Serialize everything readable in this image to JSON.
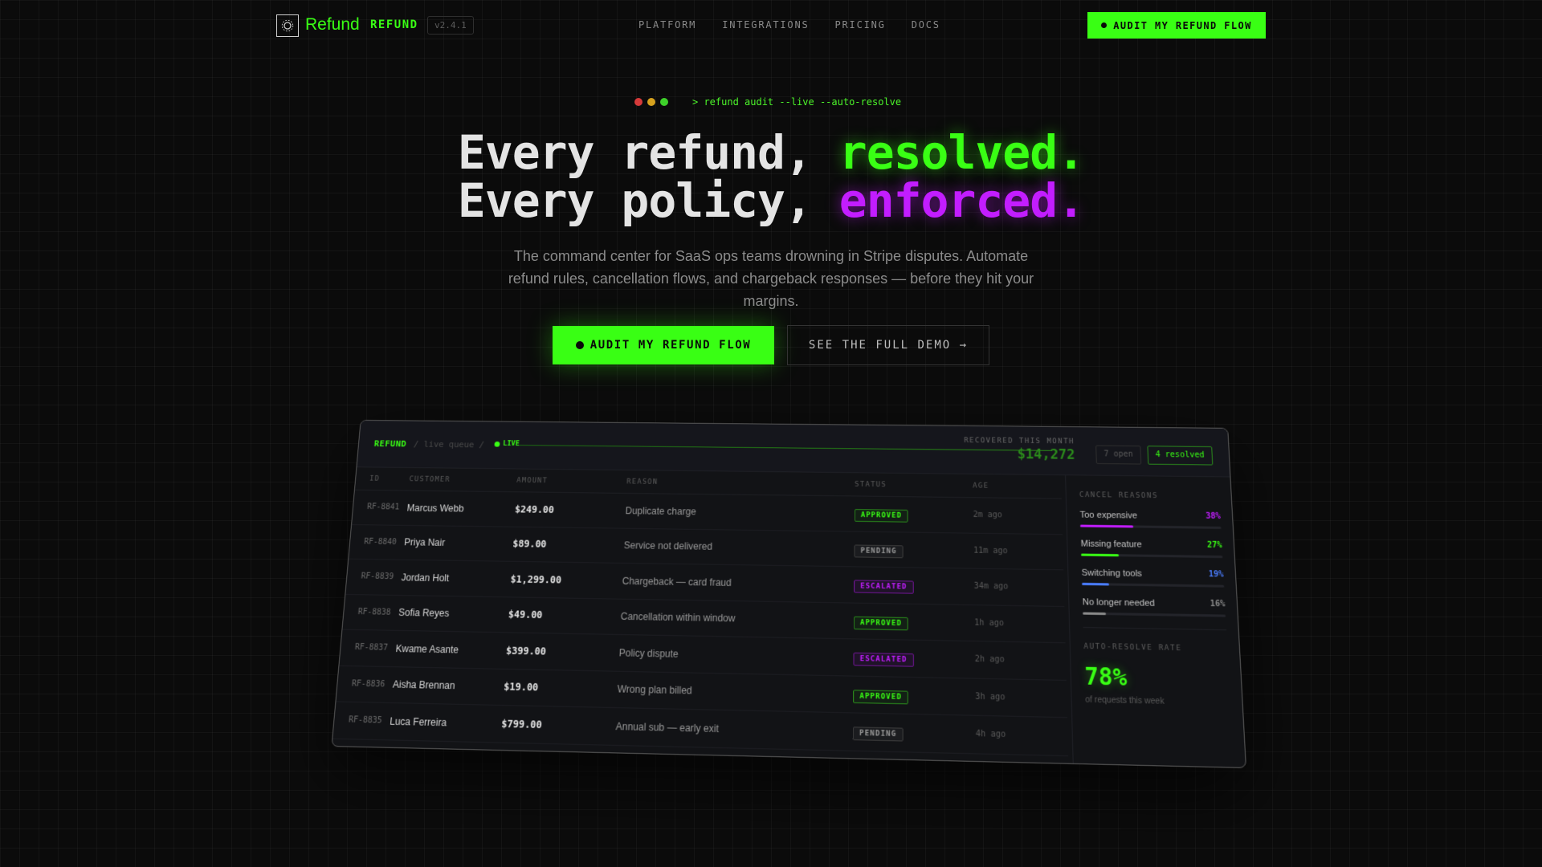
{
  "nav": {
    "brand": "Refund",
    "brand_tag": "REFUND",
    "version": "v2.4.1",
    "links": [
      "PLATFORM",
      "INTEGRATIONS",
      "PRICING",
      "DOCS"
    ],
    "cta": "AUDIT MY REFUND FLOW"
  },
  "hero": {
    "command": "> refund audit --live --auto-resolve",
    "line1_prefix": "Every refund, ",
    "line1_highlight": "resolved.",
    "line2_prefix": "Every policy, ",
    "line2_highlight": "enforced.",
    "subtitle": "The command center for SaaS ops teams drowning in Stripe disputes. Automate refund rules, cancellation flows, and chargeback responses — before they hit your margins.",
    "cta_primary": "AUDIT MY REFUND FLOW",
    "cta_secondary": "SEE THE FULL DEMO →"
  },
  "dashboard": {
    "brand": "REFUND",
    "path": "/ live queue /",
    "live_label": "LIVE",
    "recovered_label": "RECOVERED THIS MONTH",
    "recovered_value": "$14,272",
    "open_count": "7 open",
    "resolved_count": "4 resolved",
    "columns": [
      "ID",
      "CUSTOMER",
      "AMOUNT",
      "REASON",
      "STATUS",
      "AGE"
    ],
    "rows": [
      {
        "id": "RF-8841",
        "customer": "Marcus Webb",
        "amount": "$249.00",
        "reason": "Duplicate charge",
        "status": "APPROVED",
        "age": "2m ago"
      },
      {
        "id": "RF-8840",
        "customer": "Priya Nair",
        "amount": "$89.00",
        "reason": "Service not delivered",
        "status": "PENDING",
        "age": "11m ago"
      },
      {
        "id": "RF-8839",
        "customer": "Jordan Holt",
        "amount": "$1,299.00",
        "reason": "Chargeback — card fraud",
        "status": "ESCALATED",
        "age": "34m ago"
      },
      {
        "id": "RF-8838",
        "customer": "Sofia Reyes",
        "amount": "$49.00",
        "reason": "Cancellation within window",
        "status": "APPROVED",
        "age": "1h ago"
      },
      {
        "id": "RF-8837",
        "customer": "Kwame Asante",
        "amount": "$399.00",
        "reason": "Policy dispute",
        "status": "ESCALATED",
        "age": "2h ago"
      },
      {
        "id": "RF-8836",
        "customer": "Aisha Brennan",
        "amount": "$19.00",
        "reason": "Wrong plan billed",
        "status": "APPROVED",
        "age": "3h ago"
      },
      {
        "id": "RF-8835",
        "customer": "Luca Ferreira",
        "amount": "$799.00",
        "reason": "Annual sub — early exit",
        "status": "PENDING",
        "age": "4h ago"
      }
    ],
    "cancel_reasons_title": "CANCEL REASONS",
    "cancel_reasons": [
      {
        "label": "Too expensive",
        "pct": "38%",
        "value": 38,
        "color": "#c21dff"
      },
      {
        "label": "Missing feature",
        "pct": "27%",
        "value": 27,
        "color": "#39ff14"
      },
      {
        "label": "Switching tools",
        "pct": "19%",
        "value": 19,
        "color": "#4a7dff"
      },
      {
        "label": "No longer needed",
        "pct": "16%",
        "value": 16,
        "color": "#8a8a8a"
      }
    ],
    "auto_resolve_title": "AUTO-RESOLVE RATE",
    "auto_resolve_value": "78%",
    "auto_resolve_sub": "of requests this week"
  },
  "colors": {
    "accent_green": "#39ff14",
    "accent_purple": "#c21dff",
    "background": "#0b0b0b"
  }
}
